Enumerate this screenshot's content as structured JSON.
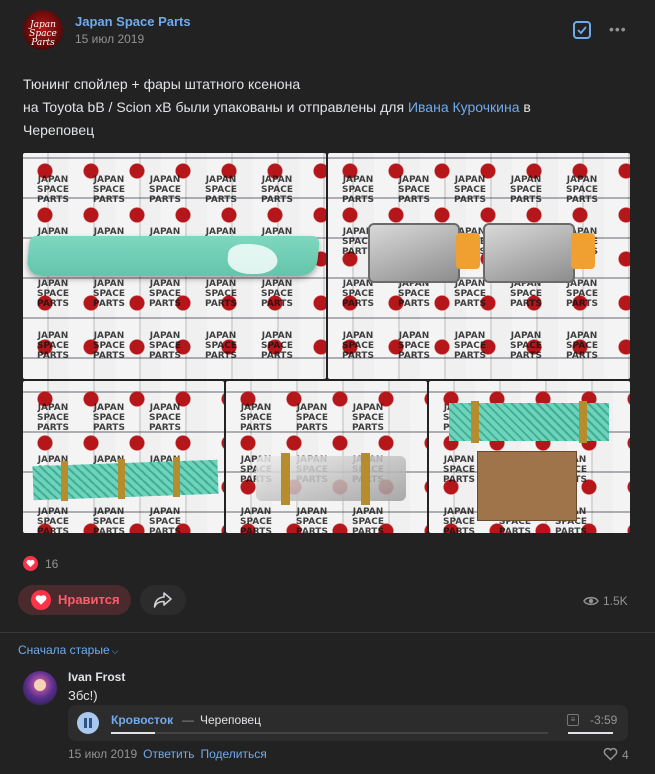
{
  "post": {
    "author": "Japan Space Parts",
    "avatar_text": "Japan Space Parts",
    "date": "15 июл 2019",
    "text_line1": "Тюнинг спойлер + фары штатного ксенона",
    "text_line2_prefix": "на Toyota bB / Scion xB были упакованы и отправлены для ",
    "text_link": "Ивана Курочкина",
    "text_line2_suffix": " в",
    "text_line3": "Череповец",
    "icons": {
      "check": "checkbox-icon",
      "more": "more-dots-icon"
    },
    "watermark": "JAPAN SPACE PARTS"
  },
  "reactions": {
    "like_count": "16",
    "like_label": "Нравится",
    "views": "1.5K",
    "icons": {
      "like": "heart-icon",
      "share": "share-icon",
      "views": "eye-icon"
    }
  },
  "comments": {
    "sort_label": "Сначала старые",
    "items": [
      {
        "author": "Ivan Frost",
        "text": "Збс!)",
        "audio": {
          "artist": "Кровосток",
          "separator": "—",
          "title": "Череповец",
          "duration": "-3:59",
          "progress_fraction": 0.1
        },
        "date": "15 июл 2019",
        "reply_label": "Ответить",
        "share_label": "Поделиться",
        "likes": "4"
      }
    ]
  },
  "colors": {
    "accent": "#71aaeb",
    "like": "#ff3347",
    "background": "#222222"
  }
}
